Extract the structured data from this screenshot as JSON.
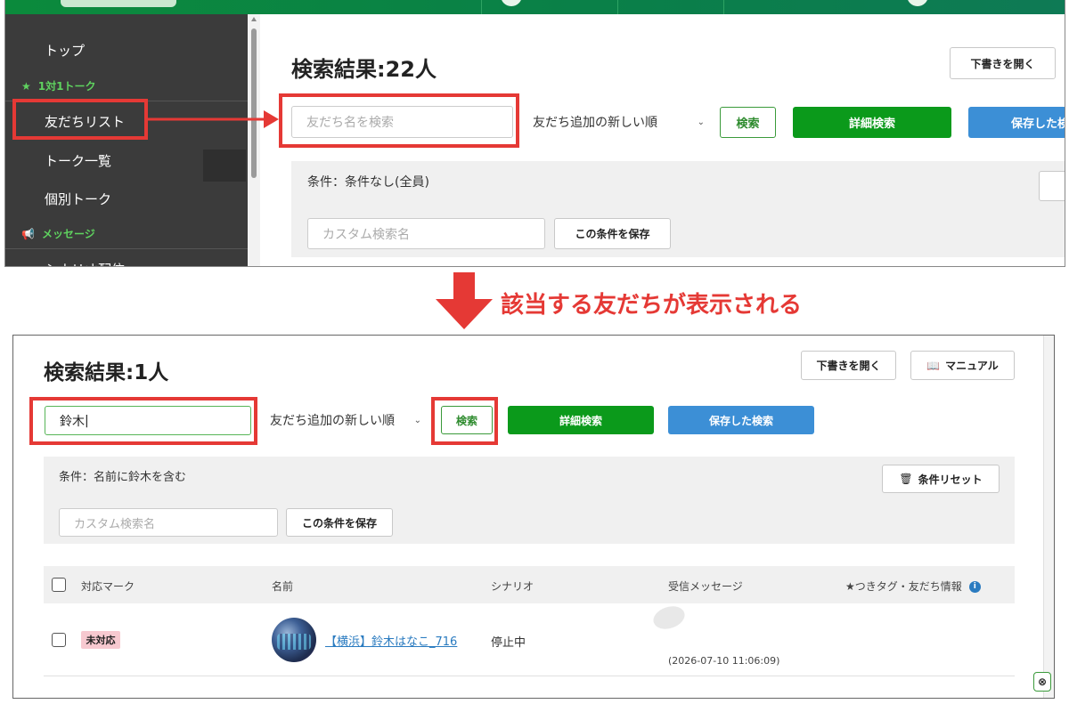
{
  "colors": {
    "brand_green": "#0b9a1b",
    "accent_blue": "#3c8fd6",
    "highlight_red": "#e53935",
    "sidebar_bg": "#3b3b3b",
    "section_green": "#5fd35f"
  },
  "top": {
    "sidebar": {
      "top_label": "トップ",
      "section_talk": "1対1トーク",
      "section_talk_icon": "star-icon",
      "items": [
        {
          "label": "友だちリスト"
        },
        {
          "label": "トーク一覧"
        },
        {
          "label": "個別トーク"
        }
      ],
      "section_message": "メッセージ",
      "section_message_icon": "megaphone-icon",
      "cut_item": "シナリオ配信"
    },
    "title": "検索結果:22人",
    "draft_button": "下書きを開く",
    "search_placeholder": "友だち名を検索",
    "sort_value": "友だち追加の新しい順",
    "search_button": "検索",
    "advanced_button": "詳細検索",
    "saved_button": "保存した検索",
    "condition": "条件：条件なし(全員)",
    "custom_placeholder": "カスタム検索名",
    "save_condition_button": "この条件を保存"
  },
  "caption": "該当する友だちが表示される",
  "bottom": {
    "title": "検索結果:1人",
    "draft_button": "下書きを開く",
    "manual_button": "マニュアル",
    "search_value": "鈴木",
    "sort_value": "友だち追加の新しい順",
    "search_button": "検索",
    "advanced_button": "詳細検索",
    "saved_button": "保存した検索",
    "condition": "条件：名前に鈴木を含む",
    "reset_button": "条件リセット",
    "custom_placeholder": "カスタム検索名",
    "save_condition_button": "この条件を保存",
    "table": {
      "headers": [
        "対応マーク",
        "名前",
        "シナリオ",
        "受信メッセージ",
        "★つきタグ・友だち情報"
      ],
      "rows": [
        {
          "mark": "未対応",
          "name": "【横浜】鈴木はなこ_716",
          "scenario": "停止中",
          "received": "(2026-07-10 11:06:09)"
        }
      ]
    }
  }
}
